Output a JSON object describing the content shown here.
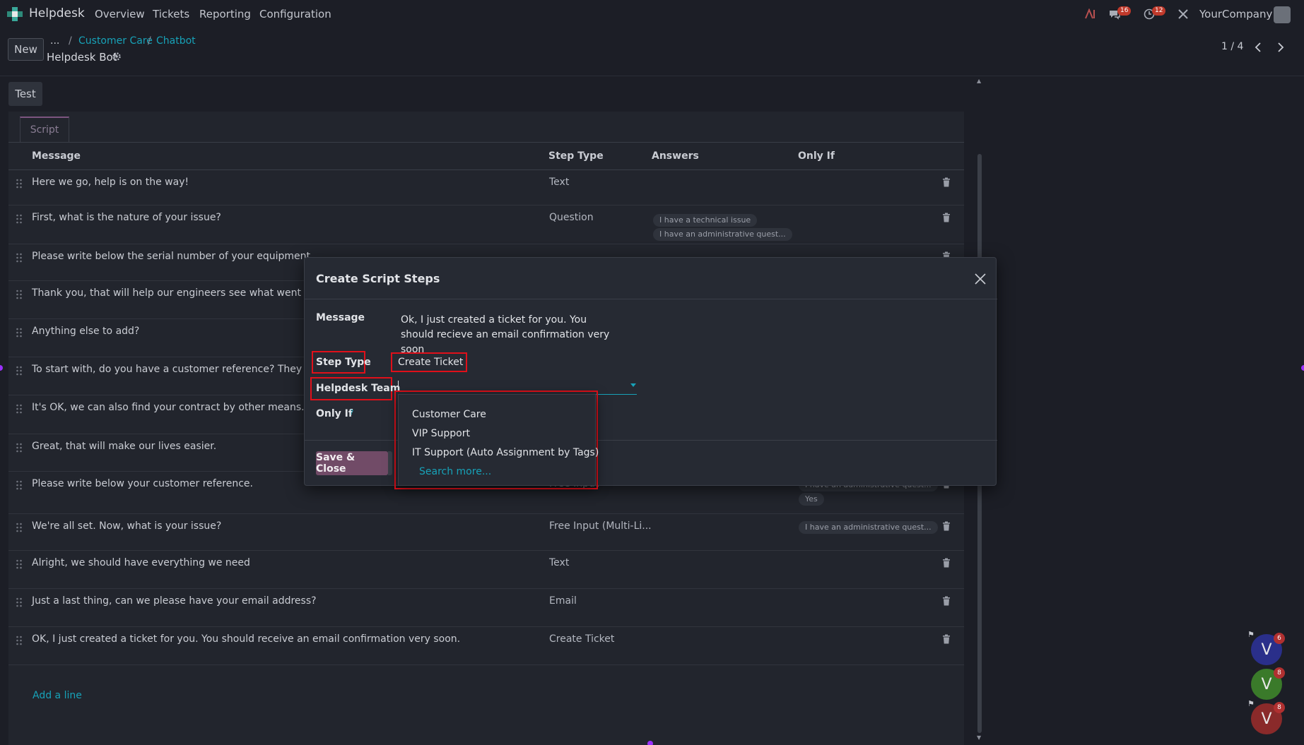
{
  "navbar": {
    "app_name": "Helpdesk",
    "menu": [
      "Overview",
      "Tickets",
      "Reporting",
      "Configuration"
    ],
    "messages_badge": "16",
    "activities_badge": "12",
    "company": "YourCompany"
  },
  "control_panel": {
    "new_label": "New",
    "breadcrumb": {
      "ellipsis": "...",
      "items": [
        "Customer Care",
        "Chatbot"
      ],
      "separator": "/"
    },
    "record_title": "Helpdesk Bot",
    "pager": "1 / 4"
  },
  "form": {
    "test_label": "Test",
    "tab_label": "Script",
    "columns": [
      "Message",
      "Step Type",
      "Answers",
      "Only If"
    ],
    "rows": [
      {
        "message": "Here we go, help is on the way!",
        "type": "Text",
        "answers": [],
        "only_if": []
      },
      {
        "message": "First, what is the nature of your issue?",
        "type": "Question",
        "answers": [
          "I have a technical issue",
          "I have an administrative quest..."
        ],
        "only_if": []
      },
      {
        "message": "Please write below the serial number of your equipment.",
        "type": "",
        "answers": [],
        "only_if": []
      },
      {
        "message": "Thank you, that will help our engineers see what went wrong",
        "type": "",
        "answers": [],
        "only_if": []
      },
      {
        "message": "Anything else to add?",
        "type": "",
        "answers": [],
        "only_if": []
      },
      {
        "message": "To start with, do you have a customer reference? They are wr",
        "type": "",
        "answers": [],
        "only_if": []
      },
      {
        "message": "It's OK, we can also find your contract by other means.",
        "type": "",
        "answers": [],
        "only_if": []
      },
      {
        "message": "Great, that will make our lives easier.",
        "type": "",
        "answers": [],
        "only_if": []
      },
      {
        "message": "Please write below your customer reference.",
        "type": "Free Input",
        "answers": [],
        "only_if": [
          "I have an administrative quest...",
          "Yes"
        ]
      },
      {
        "message": "We're all set. Now, what is your issue?",
        "type": "Free Input (Multi-Li...",
        "answers": [],
        "only_if": [
          "I have an administrative quest..."
        ]
      },
      {
        "message": "Alright, we should have everything we need",
        "type": "Text",
        "answers": [],
        "only_if": []
      },
      {
        "message": "Just a last thing, can we please have your email address?",
        "type": "Email",
        "answers": [],
        "only_if": []
      },
      {
        "message": "OK, I just created a ticket for you. You should receive an email confirmation very soon.",
        "type": "Create Ticket",
        "answers": [],
        "only_if": []
      }
    ],
    "add_line": "Add a line"
  },
  "modal": {
    "title": "Create Script Steps",
    "message_label": "Message",
    "message_value": "Ok, I just created a ticket for you. You should recieve an email confirmation very soon",
    "step_type_label": "Step Type",
    "step_type_value": "Create Ticket",
    "team_label": "Helpdesk Team",
    "team_value": "",
    "only_if_label": "Only If",
    "only_if_help": "?",
    "save_label": "Save & Close"
  },
  "dropdown": {
    "options": [
      "Customer Care",
      "VIP Support",
      "IT Support (Auto Assignment by Tags)"
    ],
    "search_more": "Search more..."
  },
  "chat_bubbles": [
    {
      "letter": "V",
      "badge": "6",
      "color": "#2a2f8a"
    },
    {
      "letter": "V",
      "badge": "8",
      "color": "#3a7a2a"
    },
    {
      "letter": "V",
      "badge": "8",
      "color": "#8a2a2a"
    }
  ],
  "colors": {
    "accent": "#17a2b8",
    "primary": "#714b67",
    "highlight": "#e0101a"
  }
}
